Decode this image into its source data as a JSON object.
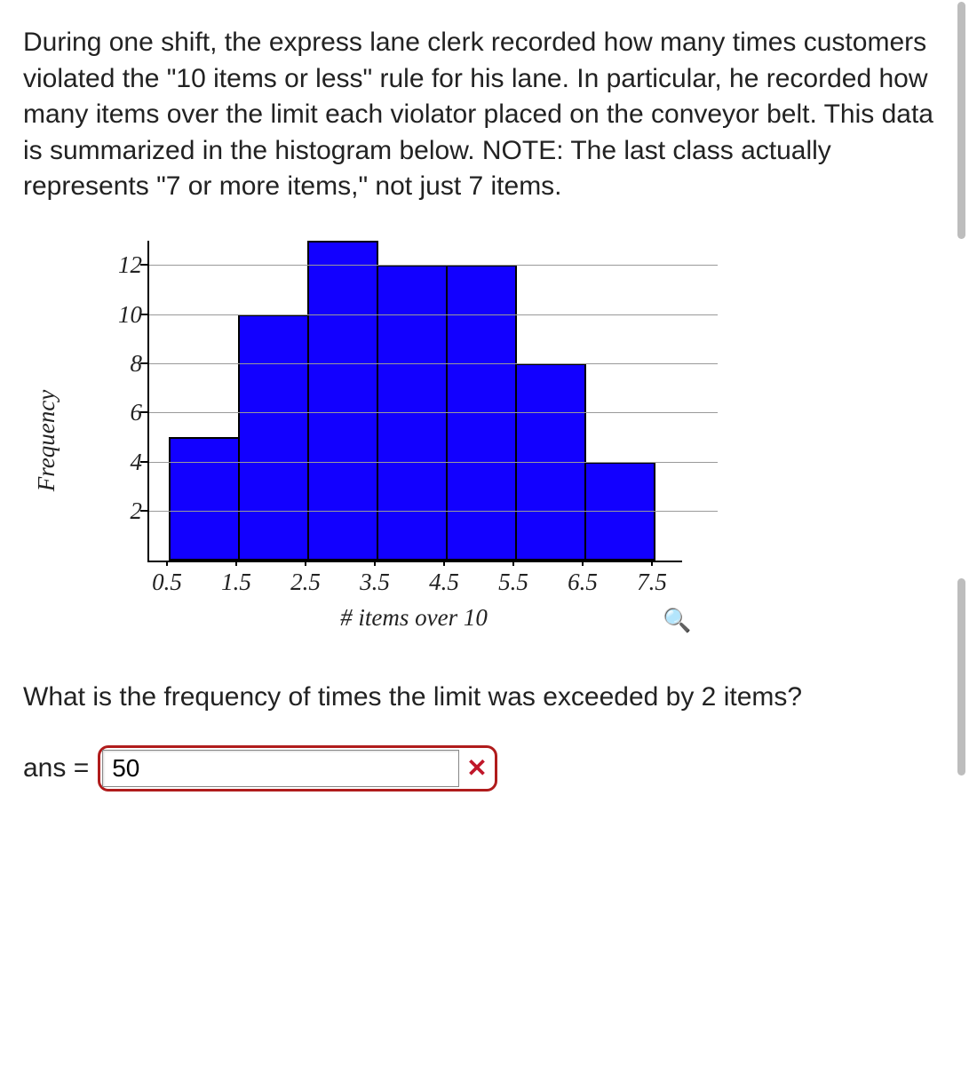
{
  "problem_text": "During one shift, the express lane clerk recorded how many times customers violated the \"10 items or less\" rule for his lane. In particular, he recorded how many items over the limit each violator placed on the conveyor belt. This data is summarized in the histogram below. NOTE: The last class actually represents \"7 or more items,\" not just 7 items.",
  "question_text": "What is the frequency of times the limit was exceeded by 2 items?",
  "answer": {
    "label": "ans =",
    "value": "50",
    "status_icon": "✕"
  },
  "zoom_icon": "🔍",
  "chart_data": {
    "type": "bar",
    "x_boundaries": [
      0.5,
      1.5,
      2.5,
      3.5,
      4.5,
      5.5,
      6.5,
      7.5
    ],
    "categories": [
      "1",
      "2",
      "3",
      "4",
      "5",
      "6",
      "7"
    ],
    "values": [
      5,
      10,
      13,
      12,
      12,
      8,
      4
    ],
    "xlabel": "# items over 10",
    "ylabel": "Frequency",
    "yticks": [
      2,
      4,
      6,
      8,
      10,
      12
    ],
    "ylim": [
      0,
      13
    ],
    "title": ""
  }
}
